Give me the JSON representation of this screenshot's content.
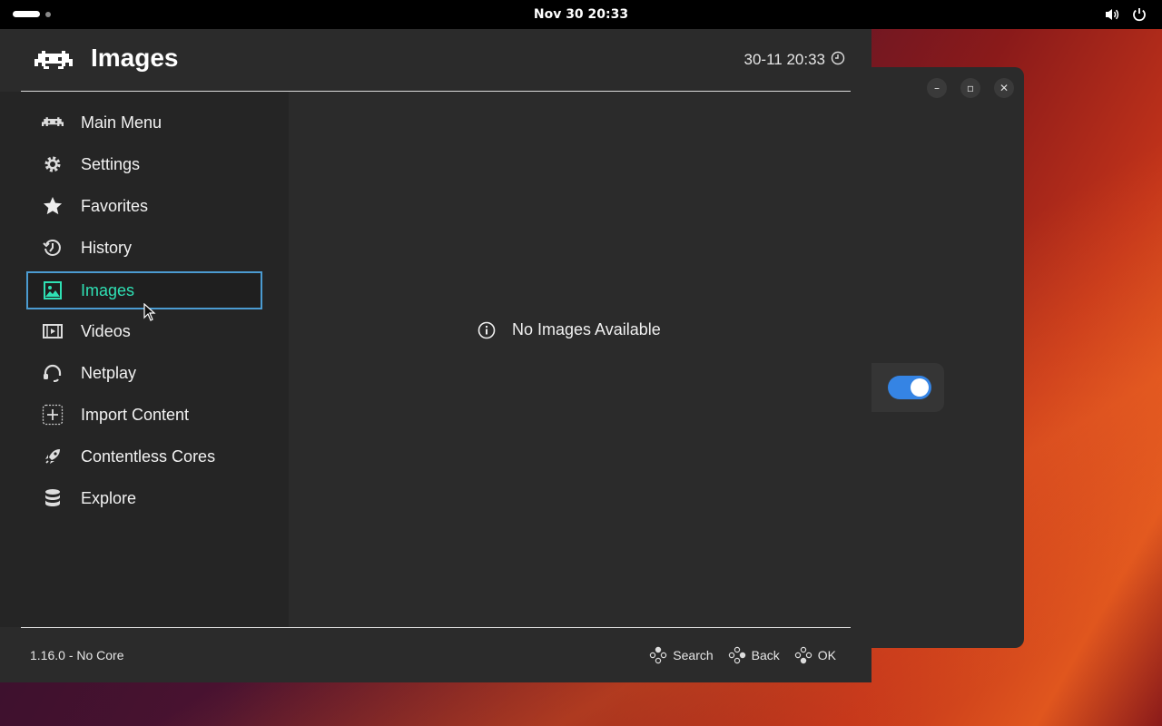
{
  "topbar": {
    "clock": "Nov 30  20:33",
    "tray_icons": [
      "volume-icon",
      "power-icon"
    ]
  },
  "retroarch": {
    "title": "Images",
    "datetime": "30-11 20:33",
    "menu": [
      {
        "label": "Main Menu",
        "icon": "retroarch-invader-icon",
        "selected": false
      },
      {
        "label": "Settings",
        "icon": "gear-icon",
        "selected": false
      },
      {
        "label": "Favorites",
        "icon": "star-icon",
        "selected": false
      },
      {
        "label": "History",
        "icon": "history-icon",
        "selected": false
      },
      {
        "label": "Images",
        "icon": "image-icon",
        "selected": true
      },
      {
        "label": "Videos",
        "icon": "film-icon",
        "selected": false
      },
      {
        "label": "Netplay",
        "icon": "headset-icon",
        "selected": false
      },
      {
        "label": "Import Content",
        "icon": "plus-icon",
        "selected": false
      },
      {
        "label": "Contentless Cores",
        "icon": "rocket-icon",
        "selected": false
      },
      {
        "label": "Explore",
        "icon": "database-icon",
        "selected": false
      }
    ],
    "empty_message": "No Images Available",
    "footer": {
      "version": "1.16.0 - No Core",
      "actions": [
        {
          "label": "Search",
          "icon": "gamepad-buttons-icon"
        },
        {
          "label": "Back",
          "icon": "gamepad-buttons-icon"
        },
        {
          "label": "OK",
          "icon": "gamepad-buttons-icon"
        }
      ]
    }
  },
  "colors": {
    "selected_text": "#2fe0b4",
    "selected_border": "#4b9bd1",
    "toggle_on": "#3584e4"
  },
  "background_window": {
    "toggle_on": true
  }
}
